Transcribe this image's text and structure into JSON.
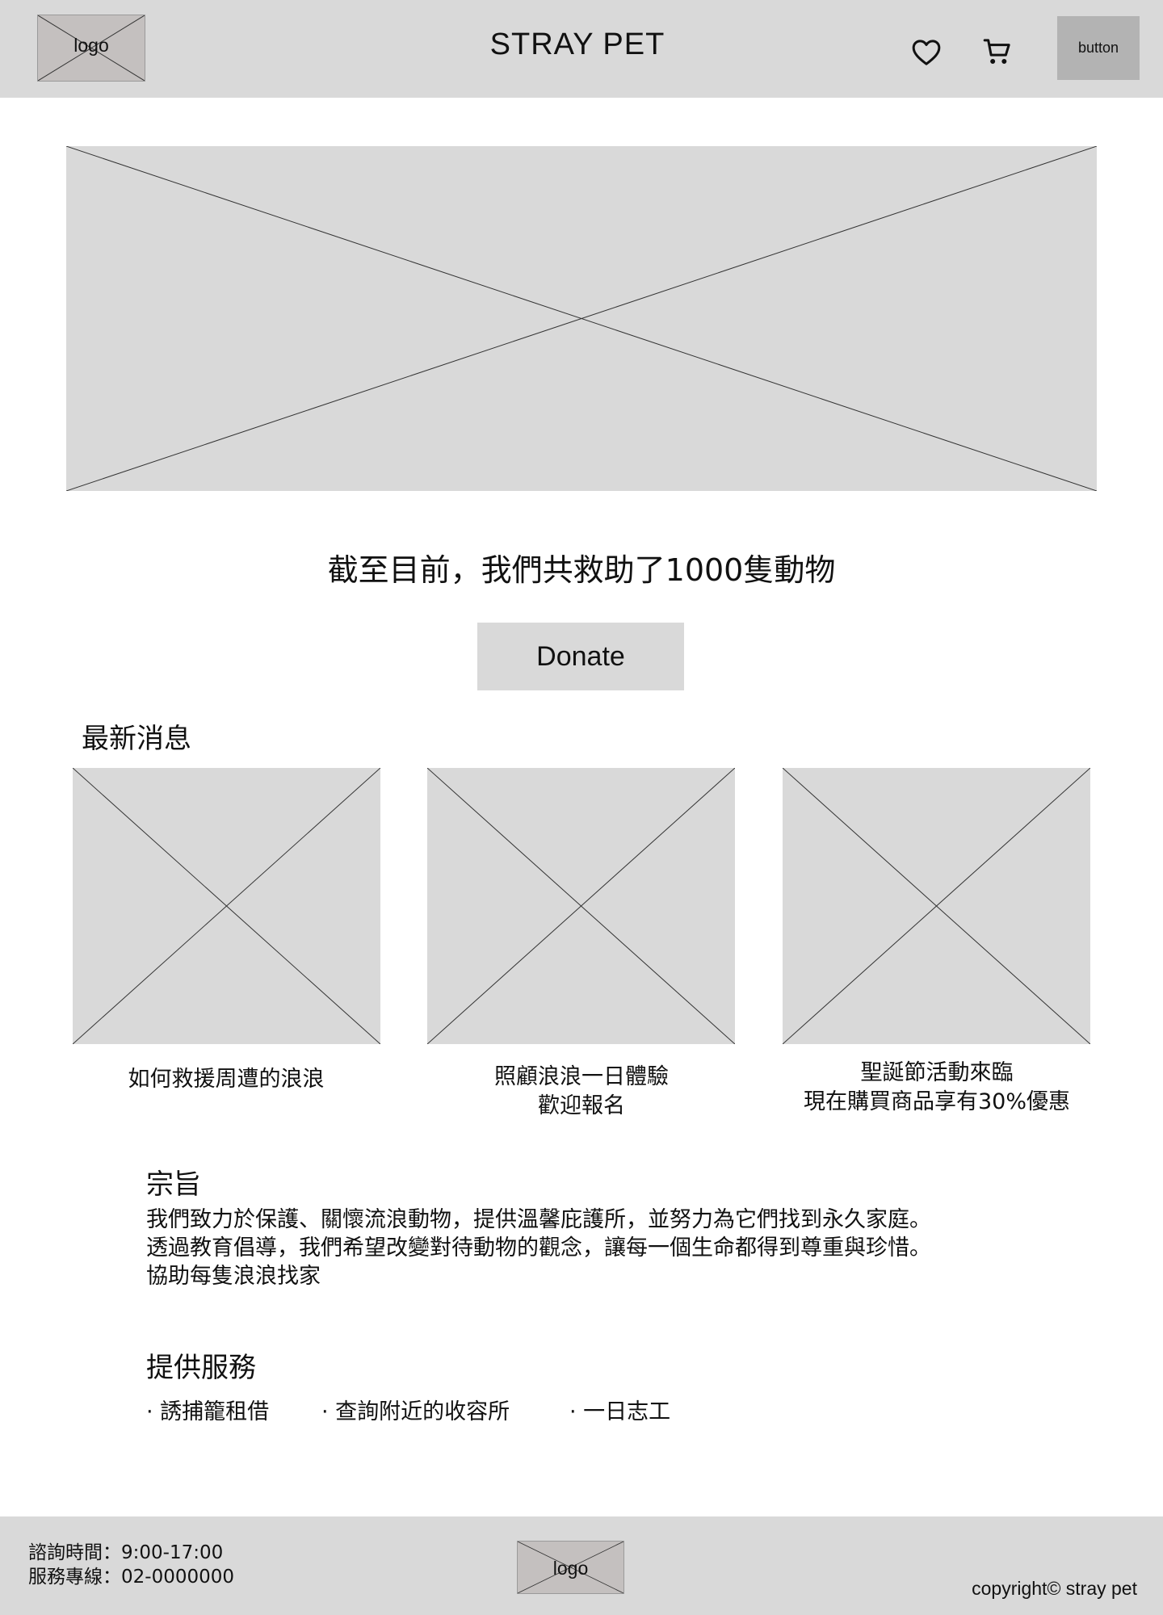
{
  "header": {
    "logo_label": "logo",
    "title": "STRAY PET",
    "favorites_icon": "heart-icon",
    "cart_icon": "cart-icon",
    "button_label": "button"
  },
  "hero": {
    "image": "image-placeholder"
  },
  "rescue": {
    "text": "截至目前，我們共救助了1000隻動物",
    "donate_label": "Donate"
  },
  "news": {
    "heading": "最新消息",
    "items": [
      {
        "lines": [
          "如何救援周遭的浪浪"
        ]
      },
      {
        "lines": [
          "照顧浪浪一日體驗",
          "歡迎報名"
        ]
      },
      {
        "lines": [
          "聖誕節活動來臨",
          "現在購買商品享有30%優惠"
        ]
      }
    ]
  },
  "mission": {
    "heading": "宗旨",
    "lines": [
      "我們致力於保護、關懷流浪動物，提供溫馨庇護所，並努力為它們找到永久家庭。",
      "透過教育倡導，我們希望改變對待動物的觀念，讓每一個生命都得到尊重與珍惜。",
      "協助每隻浪浪找家"
    ]
  },
  "services": {
    "heading": "提供服務",
    "items": [
      "· 誘捕籠租借",
      "· 查詢附近的收容所",
      "· 一日志工"
    ]
  },
  "footer": {
    "hours": "諮詢時間：9:00-17:00",
    "phone": "服務專線：02-0000000",
    "logo_label": "logo",
    "copyright": "copyright© stray pet"
  },
  "colors": {
    "placeholder": "#d9d9d9",
    "header_button": "#b3b3b3",
    "logo_box": "#c4c0bf"
  }
}
